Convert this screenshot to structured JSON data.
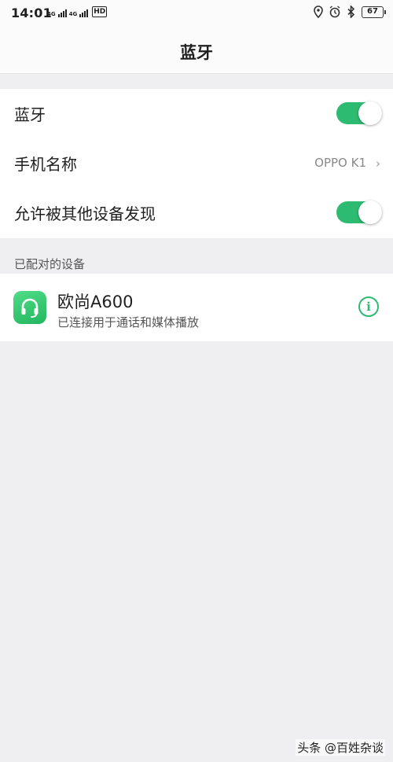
{
  "status_bar": {
    "time": "14:01",
    "network_1": "4G",
    "network_2": "4G",
    "hd_label": "HD",
    "battery_level": "67"
  },
  "nav": {
    "title": "蓝牙"
  },
  "settings": {
    "bluetooth_label": "蓝牙",
    "bluetooth_enabled": true,
    "phone_name_label": "手机名称",
    "phone_name_value": "OPPO K1",
    "discoverable_label": "允许被其他设备发现",
    "discoverable_enabled": true
  },
  "paired": {
    "header": "已配对的设备",
    "devices": [
      {
        "name": "欧尚A600",
        "status": "已连接用于通话和媒体播放",
        "icon": "headset-icon",
        "info_icon": "info-icon"
      }
    ]
  },
  "watermark": "头条 @百姓杂谈",
  "colors": {
    "accent": "#2dbb72",
    "background": "#efeff1"
  }
}
